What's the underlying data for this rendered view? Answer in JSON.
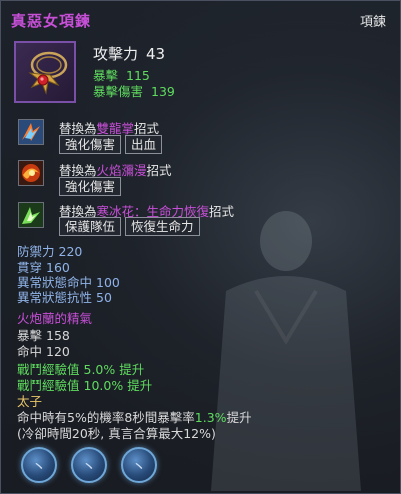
{
  "item": {
    "name": "真惡女項鍊",
    "type": "項鍊"
  },
  "main_stat": {
    "label": "攻擊力",
    "value": "43"
  },
  "sub_stats": [
    {
      "label": "暴擊",
      "value": "115"
    },
    {
      "label": "暴擊傷害",
      "value": "139"
    }
  ],
  "skills": [
    {
      "prefix": "替換為",
      "name": "雙龍掌",
      "suffix": "招式",
      "tags": [
        "強化傷害",
        "出血"
      ]
    },
    {
      "prefix": "替換為",
      "name": "火焰瀰漫",
      "suffix": "招式",
      "tags": [
        "強化傷害"
      ]
    },
    {
      "prefix": "替換為",
      "name": "寒冰花：生命力恢復",
      "suffix": "招式",
      "tags": [
        "保護隊伍",
        "恢復生命力"
      ]
    }
  ],
  "defense_stats": [
    {
      "label": "防禦力",
      "value": "220"
    },
    {
      "label": "貫穿",
      "value": "160"
    },
    {
      "label": "異常狀態命中",
      "value": "100"
    },
    {
      "label": "異常狀態抗性",
      "value": "50"
    }
  ],
  "set": {
    "name": "火炮蘭的精氣",
    "stats": [
      {
        "label": "暴擊",
        "value": "158"
      },
      {
        "label": "命中",
        "value": "120"
      }
    ],
    "exp_bonuses": [
      {
        "label": "戰鬥經驗值",
        "value": "5.0%",
        "suffix": "提升"
      },
      {
        "label": "戰鬥經驗值",
        "value": "10.0%",
        "suffix": "提升"
      }
    ]
  },
  "special": {
    "name": "太子",
    "effect_prefix": "命中時有5%的機率8秒間暴擊率",
    "effect_value": "1.3%",
    "effect_suffix": "提升",
    "effect_note": "(冷卻時間20秒, 真言合算最大12%)"
  },
  "slots": [
    {
      "glyph": "⼂"
    },
    {
      "glyph": "⼂"
    },
    {
      "glyph": "⼂"
    }
  ],
  "colors": {
    "title": "#c84fd8",
    "highlight": "#c84fd8",
    "green": "#5fdc5f",
    "blue": "#8fb3e8",
    "gold": "#e8c86a"
  }
}
